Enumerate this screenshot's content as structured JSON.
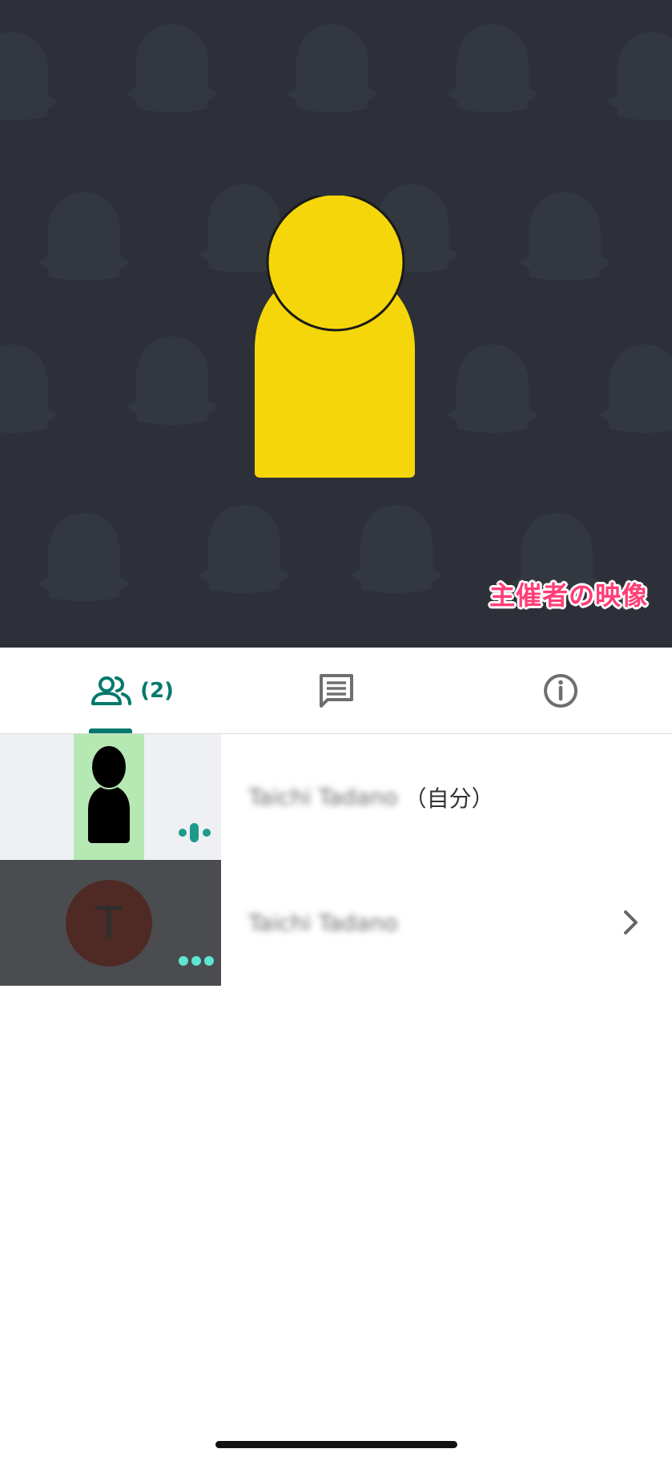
{
  "video": {
    "caption": "主催者の映像",
    "colors": {
      "background": "#2d3038",
      "avatar": "#f5d60a",
      "caption": "#ff3e77"
    }
  },
  "tabs": {
    "people": {
      "icon": "people-icon",
      "count": "(2)",
      "active": true
    },
    "chat": {
      "icon": "chat-icon"
    },
    "info": {
      "icon": "info-icon"
    },
    "accent_color": "#00796b"
  },
  "participants": [
    {
      "name": "Taichi Tadano",
      "suffix": "（自分）",
      "thumbnail": "self-video",
      "status_icon": "audio-level-icon"
    },
    {
      "name": "Taichi Tadano",
      "avatar_letter": "T",
      "status_icon": "more-dots-icon",
      "action_icon": "chevron-right-icon"
    }
  ]
}
